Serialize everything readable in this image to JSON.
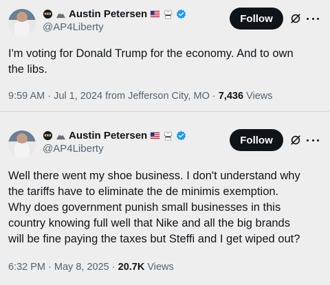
{
  "tweets": [
    {
      "author_name": "Austin Petersen",
      "handle": "@AP4Liberty",
      "follow_label": "Follow",
      "text_lines": [
        "I'm voting for Donald Trump for the economy. And to own",
        "the libs."
      ],
      "time": "9:59 AM",
      "date": "Jul 1, 2024",
      "location": "from Jefferson City, MO",
      "views_count": "7,436",
      "views_label": "Views"
    },
    {
      "author_name": "Austin Petersen",
      "handle": "@AP4Liberty",
      "follow_label": "Follow",
      "text_lines": [
        "Well there went my shoe business. I don't understand why",
        "the tariffs have to eliminate the de minimis exemption.",
        "Why does government punish small businesses in this",
        "country knowing full well that Nike and all the big brands",
        "will be fine paying the taxes but Steffi and I get wiped out?"
      ],
      "time": "6:32 PM",
      "date": "May 8, 2025",
      "views_count": "20.7K",
      "views_label": "Views"
    }
  ],
  "separator": "·",
  "icons": {
    "name_emojis": [
      "ninja-icon",
      "mountain-icon"
    ],
    "badges": [
      "us-flag-icon",
      "karate-uniform-icon",
      "verified-badge-icon"
    ],
    "actions": [
      "grok-icon",
      "more-icon"
    ]
  },
  "colors": {
    "background": "#eeeeee",
    "text": "#0f1419",
    "secondary": "#536471",
    "verified": "#1d9bf0",
    "follow_bg": "#0f1419"
  }
}
